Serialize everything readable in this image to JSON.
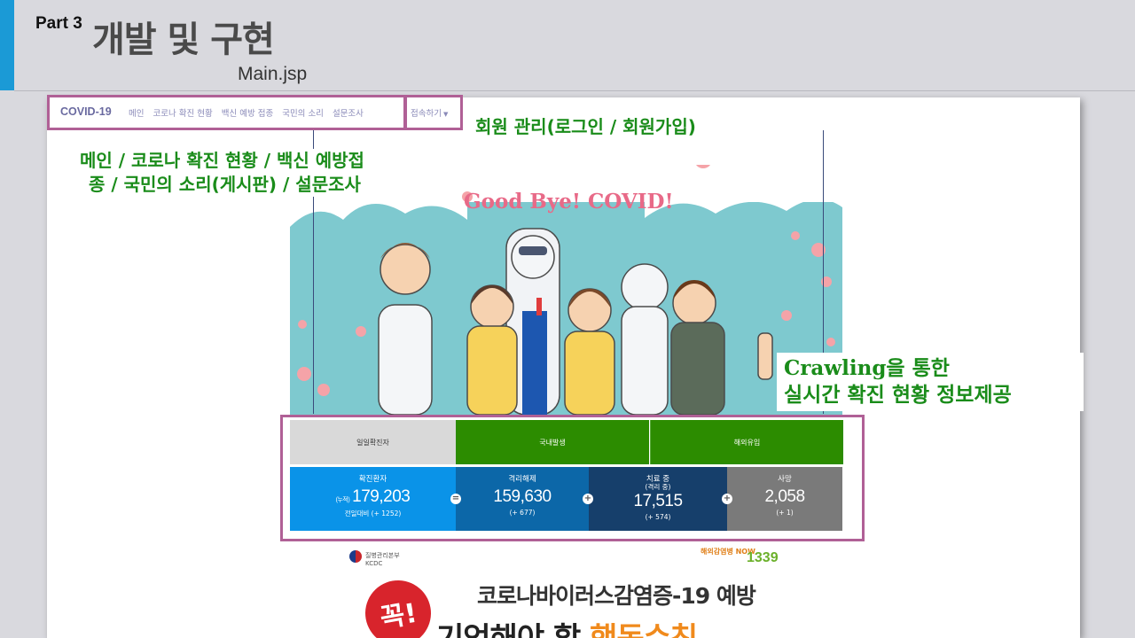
{
  "slide": {
    "part": "Part 3",
    "title": "개발 및 구현",
    "file": "Main.jsp"
  },
  "navbar": {
    "brand": "COVID-19",
    "items": [
      "메인",
      "코로나 확진 현황",
      "백신 예방 접종",
      "국민의 소리",
      "설문조사"
    ],
    "login": "접속하기"
  },
  "annotations": {
    "member": "회원 관리(로그인 / 회원가입)",
    "menu_line1": "메인 / 코로나 확진 현황 / 백신 예방접",
    "menu_line2": "종 / 국민의 소리(게시판) / 설문조사",
    "crawl_line1": "Crawling을 통한",
    "crawl_line2": "실시간 확진 현황 정보제공"
  },
  "banner": {
    "title": "Good Bye! COVID!"
  },
  "stats": {
    "headers": [
      "일일확진자",
      "국내발생",
      "해외유입"
    ],
    "cells": [
      {
        "label": "확진환자",
        "prefix": "(누적)",
        "value": "179,203",
        "sub": "전일대비 (+ 1252)",
        "color": "#0a93e8"
      },
      {
        "label": "격리해제",
        "prefix": "",
        "value": "159,630",
        "sub": "(+ 677)",
        "color": "#0c67a8"
      },
      {
        "label": "치료 중",
        "label2": "(격리 중)",
        "prefix": "",
        "value": "17,515",
        "sub": "(+ 574)",
        "color": "#163f6b"
      },
      {
        "label": "사망",
        "prefix": "",
        "value": "2,058",
        "sub": "(+ 1)",
        "color": "#7a7a7a"
      }
    ],
    "operators": [
      "=",
      "+",
      "+"
    ]
  },
  "poster": {
    "org_line1": "질병관리본부",
    "org_line2": "KCDC",
    "badge": "해외감염병 NOW",
    "hotline": "1339",
    "stamp": "꼭!",
    "line1": "코로나바이러스감염증-19 예방",
    "line2a": "기억해야 할 ",
    "line2b": "행동수칙"
  },
  "colors": {
    "accent": "#1b9ad6",
    "annotation_green": "#1a8c1a",
    "highlight_border": "#b06096",
    "header_gray": "#d9d9d9",
    "header_green": "#2c8c00"
  }
}
